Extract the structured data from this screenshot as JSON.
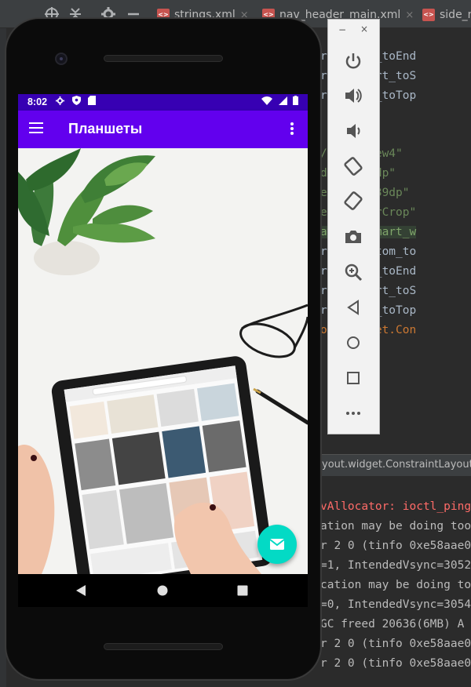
{
  "ide": {
    "tabs": [
      {
        "name": "strings.xml",
        "close": "×"
      },
      {
        "name": "nav_header_main.xml",
        "close": "×"
      },
      {
        "name": "side_n"
      }
    ],
    "code_lines": [
      {
        "text": "raintEnd_toEnd",
        "kind": "pl"
      },
      {
        "text": "raintStart_toS",
        "kind": "pl"
      },
      {
        "text": "raintTop_toTop",
        "kind": "pl"
      },
      {
        "text": "",
        "kind": "pl"
      },
      {
        "text": "",
        "kind": "pl"
      },
      {
        "text": "/imageView4\"",
        "kind": "q"
      },
      {
        "text": "dth=\"418dp\"",
        "kind": "q"
      },
      {
        "text": "eight=\"739dp\"",
        "kind": "q"
      },
      {
        "text": "e=\"centerCrop\"",
        "kind": "q"
      },
      {
        "text": "awable/smart_w",
        "kind": "gr"
      },
      {
        "text": "raintBottom_to",
        "kind": "pl"
      },
      {
        "text": "raintEnd_toEnd",
        "kind": "pl"
      },
      {
        "text": "raintStart_toS",
        "kind": "pl"
      },
      {
        "text": "raintTop_toTop",
        "kind": "pl"
      },
      {
        "text": "out.widget.Con",
        "kind": "or"
      }
    ],
    "breadcrumb": "yout.widget.ConstraintLayout",
    "log_lines": [
      {
        "text": "vAllocator: ioctl_ping",
        "kind": "err"
      },
      {
        "text": "ation may be doing too",
        "kind": "info"
      },
      {
        "text": "r 2 0 (tinfo 0xe58aae0",
        "kind": "info"
      },
      {
        "text": "=1, IntendedVsync=3052",
        "kind": "info"
      },
      {
        "text": "cation may be doing to",
        "kind": "info"
      },
      {
        "text": "=0, IntendedVsync=3054",
        "kind": "info"
      },
      {
        "text": " GC freed 20636(6MB) A",
        "kind": "info"
      },
      {
        "text": "r 2 0 (tinfo 0xe58aae0",
        "kind": "info"
      },
      {
        "text": "r 2 0 (tinfo 0xe58aae0",
        "kind": "info"
      }
    ]
  },
  "phone": {
    "status_bar": {
      "time": "8:02",
      "left_icons": [
        "gear-icon",
        "shield-icon",
        "sd-card-icon"
      ],
      "right_icons": [
        "wifi-icon",
        "signal-icon",
        "battery-icon"
      ]
    },
    "app_bar": {
      "title": "Планшеты",
      "color": "#6200ee",
      "status_color": "#3700b3"
    },
    "fab": {
      "icon": "email-icon",
      "color": "#03dac5"
    },
    "nav_bar": [
      "back-icon",
      "home-icon",
      "recents-icon"
    ]
  },
  "emulator_panel": {
    "window_controls": {
      "minimize": "−",
      "close": "×"
    },
    "buttons": [
      "power-icon",
      "volume-up-icon",
      "volume-down-icon",
      "rotate-left-icon",
      "rotate-right-icon",
      "camera-icon",
      "zoom-icon",
      "back-icon",
      "home-icon",
      "overview-icon",
      "more-icon"
    ]
  }
}
